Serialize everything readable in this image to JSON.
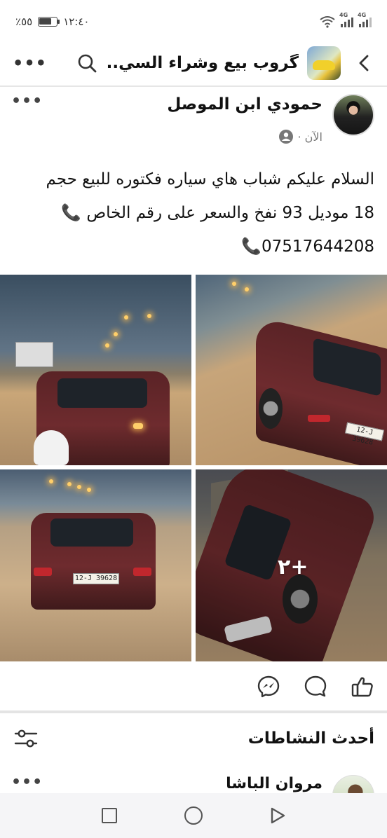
{
  "status_bar": {
    "battery": "٪٥٥",
    "time": "١٢:٤٠",
    "network_1": "4G",
    "network_2": "4G"
  },
  "topnav": {
    "group_name": "گروب بيع وشراء السي.."
  },
  "post": {
    "author": "حمودي ابن الموصل",
    "time": "الآن ·",
    "text_line_1": "السلام عليكم شباب هاي سياره فكتوره للبيع حجم",
    "text_line_2": "18 موديل 93 نفخ والسعر على رقم الخاص 📞",
    "text_line_3": "07517644208📞",
    "more_photos": "+٢",
    "plate_1": "12-J 39628",
    "plate_2": "12-J 39628"
  },
  "activity": {
    "title": "أحدث النشاطات",
    "commenter": "مروان الباشا"
  },
  "colors": {
    "accent": "#1877f2",
    "car": "#6e2b2e",
    "divider": "#e4e4e4"
  }
}
